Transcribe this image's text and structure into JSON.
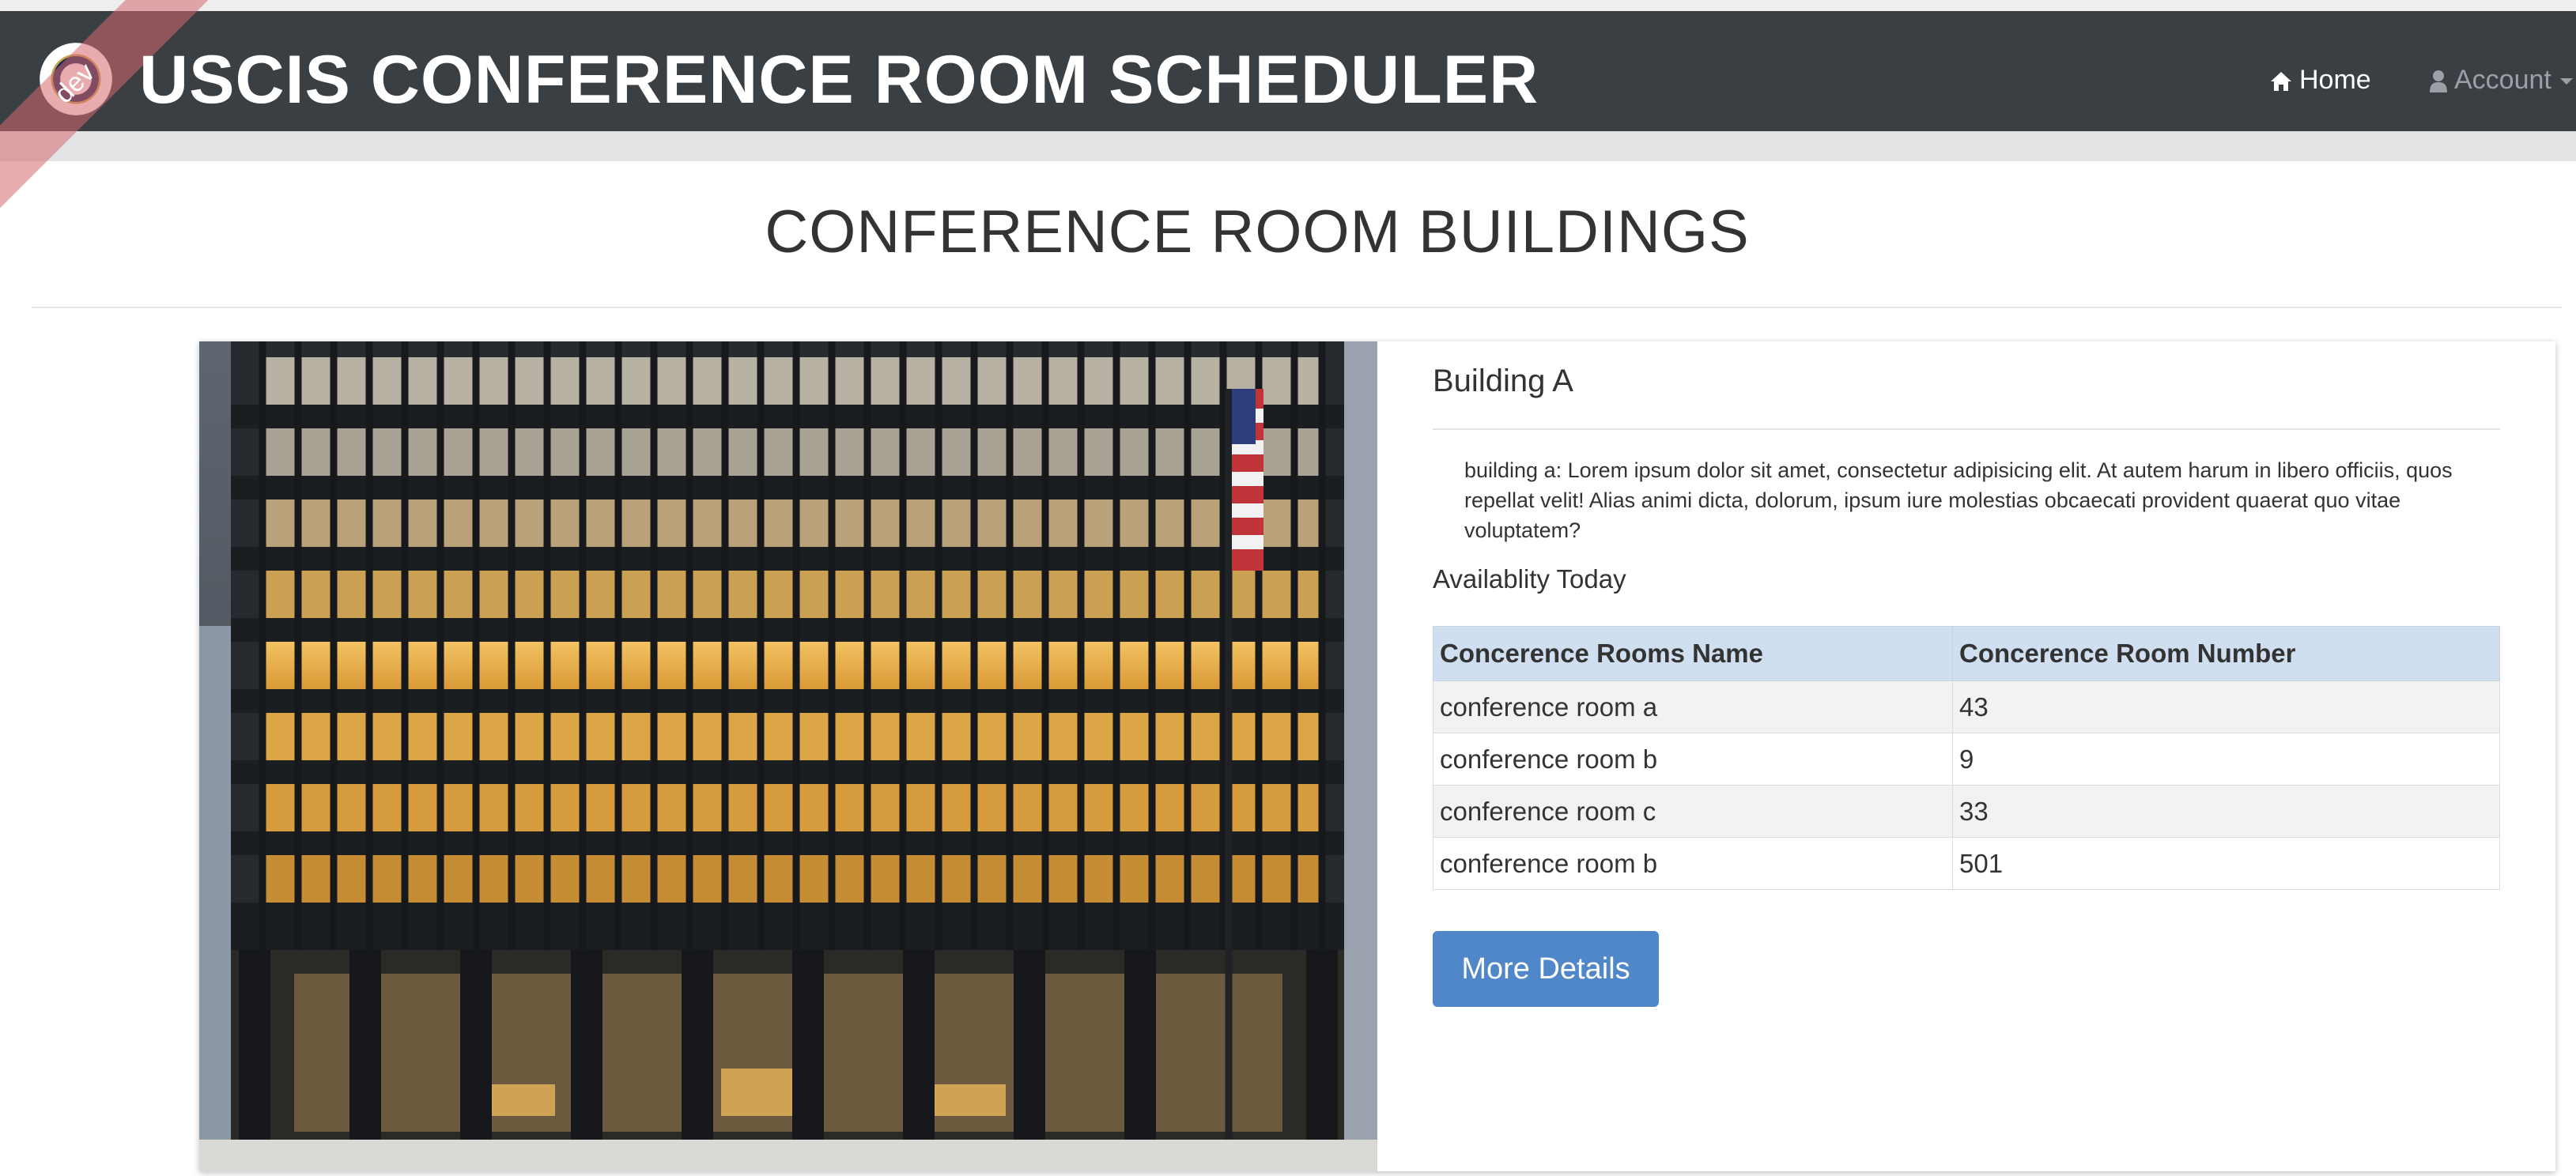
{
  "navbar": {
    "brand": "USCIS CONFERENCE ROOM SCHEDULER",
    "env_badge": "dev",
    "links": [
      {
        "label": "Home",
        "icon": "home-icon"
      },
      {
        "label": "Account",
        "icon": "user-icon"
      }
    ]
  },
  "page": {
    "title": "CONFERENCE ROOM BUILDINGS"
  },
  "building": {
    "name": "Building A",
    "description": "building a: Lorem ipsum dolor sit amet, consectetur adipisicing elit. At autem harum in libero officiis, quos repellat velit! Alias animi dicta, dolorum, ipsum iure molestias obcaecati provident quaerat quo vitae voluptatem?",
    "availability_heading": "Availablity Today",
    "table": {
      "headers": [
        "Concerence Rooms Name",
        "Concerence Room Number"
      ],
      "rows": [
        [
          "conference room a",
          "43"
        ],
        [
          "conference room b",
          "9"
        ],
        [
          "conference room c",
          "33"
        ],
        [
          "conference room b",
          "501"
        ]
      ]
    },
    "button_label": "More Details"
  },
  "colors": {
    "navbar": "#3a3f44",
    "table_header": "#cfdff0",
    "button": "#4f87c9",
    "ribbon": "#d6686e"
  }
}
